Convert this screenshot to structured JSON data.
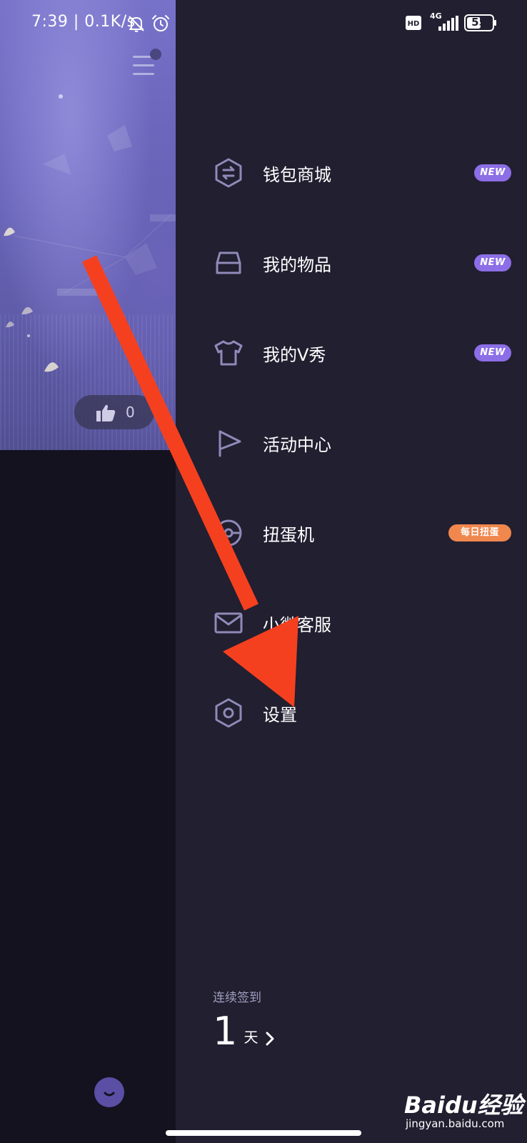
{
  "status_bar": {
    "time": "7:39 | 0.1K/s",
    "network": "4G",
    "hd": "HD",
    "battery": "55",
    "icons": [
      "bell-off-icon",
      "alarm-icon",
      "hd-icon",
      "signal-icon",
      "battery-icon"
    ]
  },
  "left_panel": {
    "like_count": "0",
    "icons": [
      "hamburger-menu-icon",
      "thumbs-up-icon",
      "smile-icon"
    ]
  },
  "drawer": {
    "items": [
      {
        "label": "钱包商城",
        "icon": "wallet-hexagon-icon",
        "badge": "NEW"
      },
      {
        "label": "我的物品",
        "icon": "inventory-box-icon",
        "badge": "NEW"
      },
      {
        "label": "我的V秀",
        "icon": "tshirt-icon",
        "badge": "NEW"
      },
      {
        "label": "活动中心",
        "icon": "flag-icon",
        "badge": ""
      },
      {
        "label": "扭蛋机",
        "icon": "capsule-machine-icon",
        "badge": "每日扭蛋"
      },
      {
        "label": "小微客服",
        "icon": "mail-icon",
        "badge": ""
      },
      {
        "label": "设置",
        "icon": "settings-hexagon-icon",
        "badge": ""
      }
    ],
    "checkin": {
      "label": "连续签到",
      "days": "1",
      "unit": "天"
    }
  },
  "colors": {
    "drawer_bg": "#211f30",
    "left_bg": "#15121f",
    "icon_stroke": "#8f8ab8",
    "badge_new": "#8c6ee6",
    "badge_orange": "#f0874d",
    "arrow": "#f5401f"
  },
  "watermark": {
    "logo": "Baidu经验",
    "sub": "jingyan.baidu.com"
  }
}
